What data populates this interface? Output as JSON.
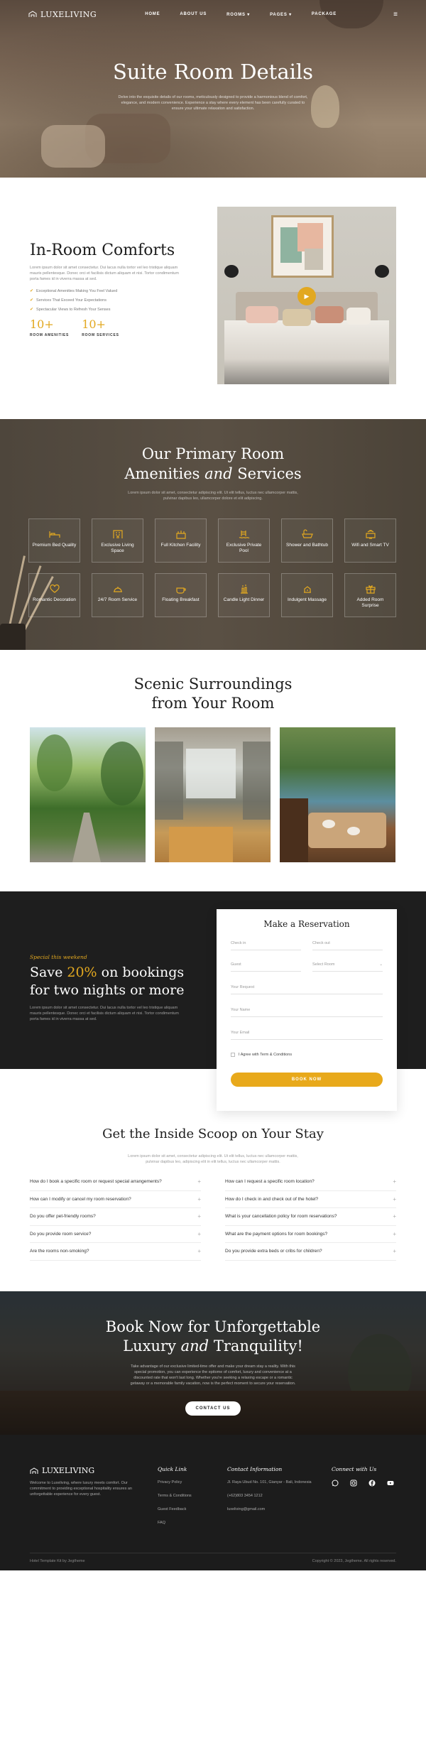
{
  "brand": {
    "name": "LUXELIVING",
    "accent": "#e2a820"
  },
  "nav": {
    "items": [
      "HOME",
      "ABOUT US",
      "ROOMS ▾",
      "PAGES ▾",
      "PACKAGE"
    ],
    "menu_icon": "≡"
  },
  "hero": {
    "title": "Suite Room Details",
    "text": "Delve into the exquisite details of our rooms, meticulously designed to provide a harmonious blend of comfort, elegance, and modern convenience. Experience a stay where every element has been carefully curated to ensure your ultimate relaxation and satisfaction."
  },
  "comforts": {
    "title": "In-Room Comforts",
    "lead": "Lorem ipsum dolor sit amet consectetur. Dui lacus nulla tortor vel leo tristique aliquam mauris pellentesque. Donec orci et facilisis dictum aliquam et nisi. Tortor condimentum porta fames id in viverra massa at sed.",
    "checks": [
      "Exceptional Amenities Making You Feel Valued",
      "Services That Exceed Your Expectations",
      "Spectacular Views to Refresh Your Senses"
    ],
    "stats": [
      {
        "num": "10+",
        "label": "ROOM AMENITIES"
      },
      {
        "num": "10+",
        "label": "ROOM SERVICES"
      }
    ]
  },
  "amenities": {
    "title_line1": "Our Primary Room",
    "title_line2_a": "Amenities ",
    "title_line2_em": "and",
    "title_line2_b": " Services",
    "sub": "Lorem ipsum dolor sit amet, consectetur adipiscing elit. Ut elit tellus, luctus nec ullamcorper mattis, pulvinar dapibus leo, ullamcorper dolore et elit adipiscing.",
    "items": [
      {
        "label": "Premium Bed Quality",
        "icon": "bed-icon"
      },
      {
        "label": "Exclusive Living Space",
        "icon": "building-icon"
      },
      {
        "label": "Full Kitchen Facility",
        "icon": "kitchen-icon"
      },
      {
        "label": "Exclusive Private Pool",
        "icon": "pool-icon"
      },
      {
        "label": "Shower and Bathtub",
        "icon": "bathtub-icon"
      },
      {
        "label": "Wifi and Smart TV",
        "icon": "wifi-icon"
      },
      {
        "label": "Romantic Decoration",
        "icon": "heart-icon"
      },
      {
        "label": "24/7 Room Service",
        "icon": "room-service-icon"
      },
      {
        "label": "Floating Breakfast",
        "icon": "breakfast-icon"
      },
      {
        "label": "Candle Light Dinner",
        "icon": "candle-icon"
      },
      {
        "label": "Indulgent Massage",
        "icon": "massage-icon"
      },
      {
        "label": "Added Room Surprise",
        "icon": "gift-icon"
      }
    ]
  },
  "scenic": {
    "title_line1": "Scenic Surroundings",
    "title_line2": "from Your Room"
  },
  "reservation": {
    "kicker": "Special this weekend",
    "title_a": "Save ",
    "title_pct": "20%",
    "title_b": " on bookings",
    "title_line2": "for two nights or more",
    "desc": "Lorem ipsum dolor sit amet consectetur. Dui lacus nulla tortor vel leo tristique aliquam mauris pellentesque. Donec orci et facilisis dictum aliquam et nisi. Tortor condimentum porta fames id in viverra massa at sed.",
    "form": {
      "title": "Make a Reservation",
      "check_in": "Check in",
      "check_out": "Check out",
      "guest": "Guest",
      "select_room": "Select Room",
      "request": "Your Request",
      "name": "Your Name",
      "email": "Your Email",
      "agree": "I Agree with Term & Conditions",
      "button": "BOOK NOW"
    }
  },
  "faq": {
    "title": "Get the Inside Scoop on Your Stay",
    "sub": "Lorem ipsum dolor sit amet, consectetur adipiscing elit. Ut elit tellus, luctus nec ullamcorper mattis, pulvinar dapibus leo, adipiscing elit in elit tellus, luctus nec ullamcorper mattis.",
    "left": [
      "How do I book a specific room or request special arrangements?",
      "How can I modify or cancel my room reservation?",
      "Do you offer pet-friendly rooms?",
      "Do you provide room service?",
      "Are the rooms non-smoking?"
    ],
    "right": [
      "How can I request a specific room location?",
      "How do I check in and check out of the hotel?",
      "What is your cancellation policy for room reservations?",
      "What are the payment options for room bookings?",
      "Do you provide extra beds or cribs for children?"
    ]
  },
  "cta": {
    "line1": "Book Now for Unforgettable",
    "line2_a": "Luxury ",
    "line2_em": "and",
    "line2_b": " Tranquility!",
    "text": "Take advantage of our exclusive limited-time offer and make your dream stay a reality. With this special promotion, you can experience the epitome of comfort, luxury and convenience at a discounted rate that won't last long. Whether you're seeking a relaxing escape or a romantic getaway or a memorable family vacation, now is the perfect moment to secure your reservation.",
    "button": "CONTACT US"
  },
  "footer": {
    "about": "Welcome to Luxeliving, where luxury meets comfort. Our commitment to providing exceptional hospitality ensures an unforgettable experience for every guest.",
    "quick_title": "Quick Link",
    "quick": [
      "Privacy Policy",
      "Terms & Conditions",
      "Guest Feedback",
      "FAQ"
    ],
    "contact_title": "Contact Information",
    "address": "Jl. Raya Ubud No. 101, Gianyar - Bali, Indonesia",
    "phone": "(+62)803 3454 1212",
    "email": "luxeliving@gmail.com",
    "connect_title": "Connect with Us",
    "socials": [
      "whatsapp-icon",
      "instagram-icon",
      "facebook-icon",
      "youtube-icon"
    ],
    "credit": "Hotel Template Kit by Jegtheme",
    "copyright": "Copyright © 2023, Jegtheme. All rights reserved."
  }
}
